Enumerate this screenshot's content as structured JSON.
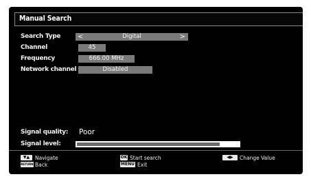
{
  "header": {
    "title": "Manual Search"
  },
  "fields": [
    {
      "label": "Search Type",
      "value": "Digital"
    },
    {
      "label": "Channel",
      "value": "45"
    },
    {
      "label": "Frequency",
      "value": "666.00 MHz"
    },
    {
      "label": "Network channel scan",
      "value": "Disabled"
    }
  ],
  "arrows": {
    "left": "<",
    "right": ">"
  },
  "signal": {
    "quality_label": "Signal quality:",
    "quality_value": "Poor",
    "level_label": "Signal level:",
    "level_fraction": 0.88
  },
  "footer": {
    "navigate_keys": "▼▲",
    "navigate": "Navigate",
    "back_key": "RETURN",
    "back": "Back",
    "ok_key": "OK",
    "start_search": "Start search",
    "menu_key": "MENU",
    "exit": "Exit",
    "change_keys": "◀▶",
    "change_value": "Change Value"
  },
  "colors": {
    "screen_bg": "#000000",
    "value_box": "#7a7a7a",
    "bar_fill": "#6b6b6b"
  }
}
